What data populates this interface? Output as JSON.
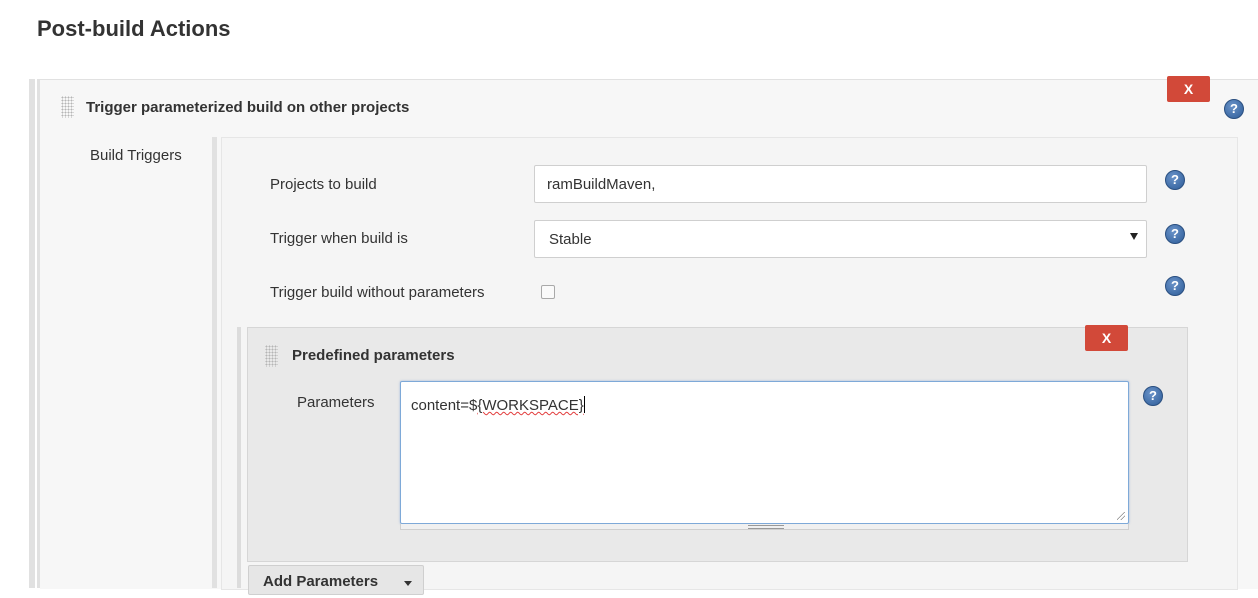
{
  "section": {
    "title": "Post-build Actions"
  },
  "trigger_block": {
    "title": "Trigger parameterized build on other projects",
    "delete_label": "X",
    "help_symbol": "?"
  },
  "build_triggers": {
    "label": "Build Triggers",
    "projects": {
      "label": "Projects to build",
      "value": "ramBuildMaven,"
    },
    "trigger_when": {
      "label": "Trigger when build is",
      "value": "Stable"
    },
    "without_params": {
      "label": "Trigger build without parameters",
      "checked": false
    }
  },
  "predefined": {
    "title": "Predefined parameters",
    "delete_label": "X",
    "params_label": "Parameters",
    "value_prefix": "content=$",
    "value_spell": "{WORKSPACE}"
  },
  "add_parameters": {
    "label": "Add Parameters"
  },
  "icons": {
    "help": "help-icon",
    "drag": "drag-handle-icon",
    "dropdown": "chevron-down-icon"
  },
  "colors": {
    "delete_button": "#d24939",
    "help_icon": "#2d5c98",
    "focus_border": "#7ea9d8"
  }
}
